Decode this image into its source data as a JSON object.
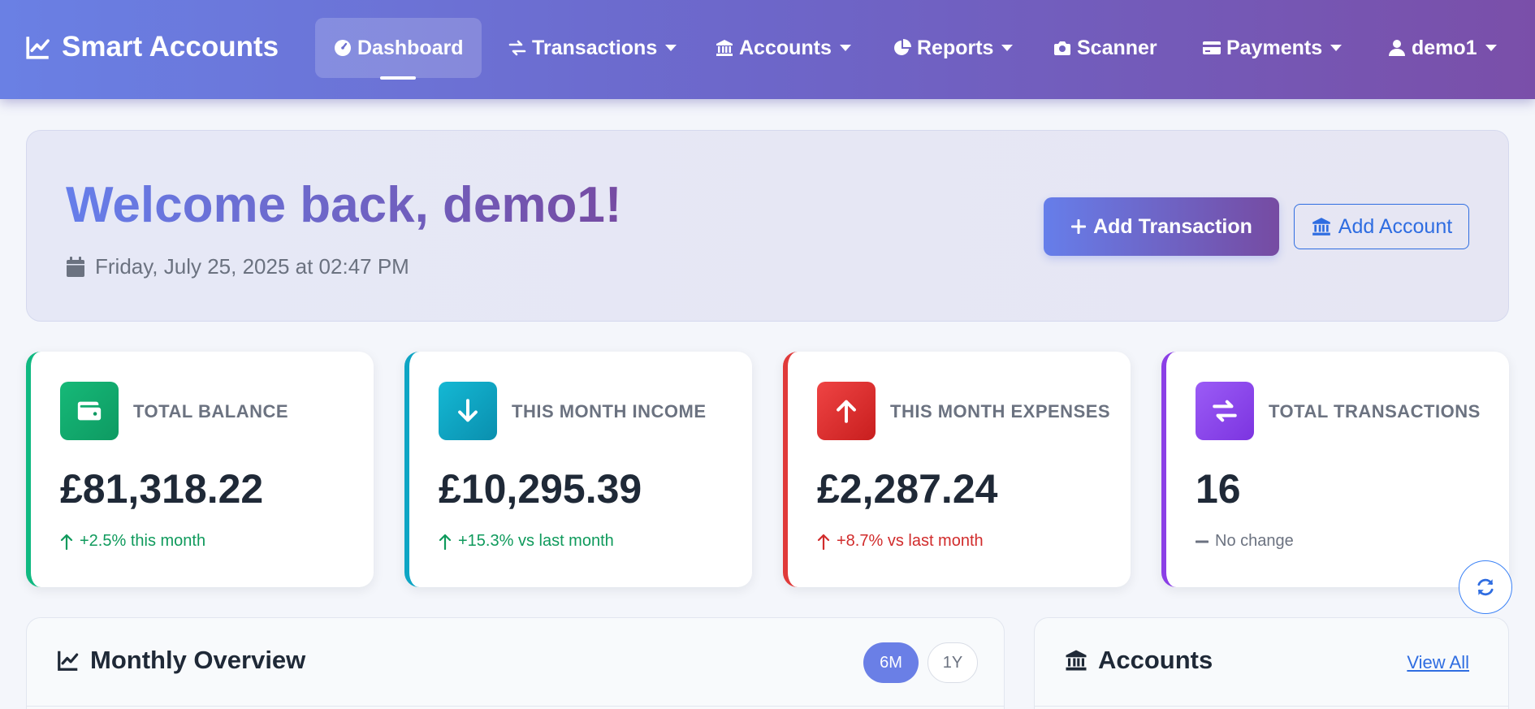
{
  "navbar": {
    "brand": "Smart Accounts",
    "items": [
      {
        "label": "Dashboard"
      },
      {
        "label": "Transactions"
      },
      {
        "label": "Accounts"
      },
      {
        "label": "Reports"
      },
      {
        "label": "Scanner"
      },
      {
        "label": "Payments"
      },
      {
        "label": "demo1"
      }
    ]
  },
  "welcome": {
    "title": "Welcome back, demo1!",
    "date": "Friday, July 25, 2025 at 02:47 PM",
    "add_transaction": "Add Transaction",
    "add_account": "Add Account"
  },
  "stats": [
    {
      "label": "TOTAL BALANCE",
      "value": "£81,318.22",
      "change": "+2.5% this month",
      "trend": "up",
      "color": "#10b981"
    },
    {
      "label": "THIS MONTH INCOME",
      "value": "£10,295.39",
      "change": "+15.3% vs last month",
      "trend": "up",
      "color": "#0ea5c4"
    },
    {
      "label": "THIS MONTH EXPENSES",
      "value": "£2,287.24",
      "change": "+8.7% vs last month",
      "trend": "up-negative",
      "color": "#e03a3a"
    },
    {
      "label": "TOTAL TRANSACTIONS",
      "value": "16",
      "change": "No change",
      "trend": "neutral",
      "color": "#8b3fe6"
    }
  ],
  "overview": {
    "title": "Monthly Overview",
    "range_6m": "6M",
    "range_1y": "1Y",
    "selected": "6M"
  },
  "accounts_panel": {
    "title": "Accounts",
    "view_all": "View All"
  },
  "colors": {
    "nav_gradient_start": "#6a80e4",
    "nav_gradient_end": "#7a4fa9",
    "positive": "#0f9a5c",
    "negative": "#d12c2c",
    "neutral": "#6b7280",
    "link": "#2f6de1"
  }
}
